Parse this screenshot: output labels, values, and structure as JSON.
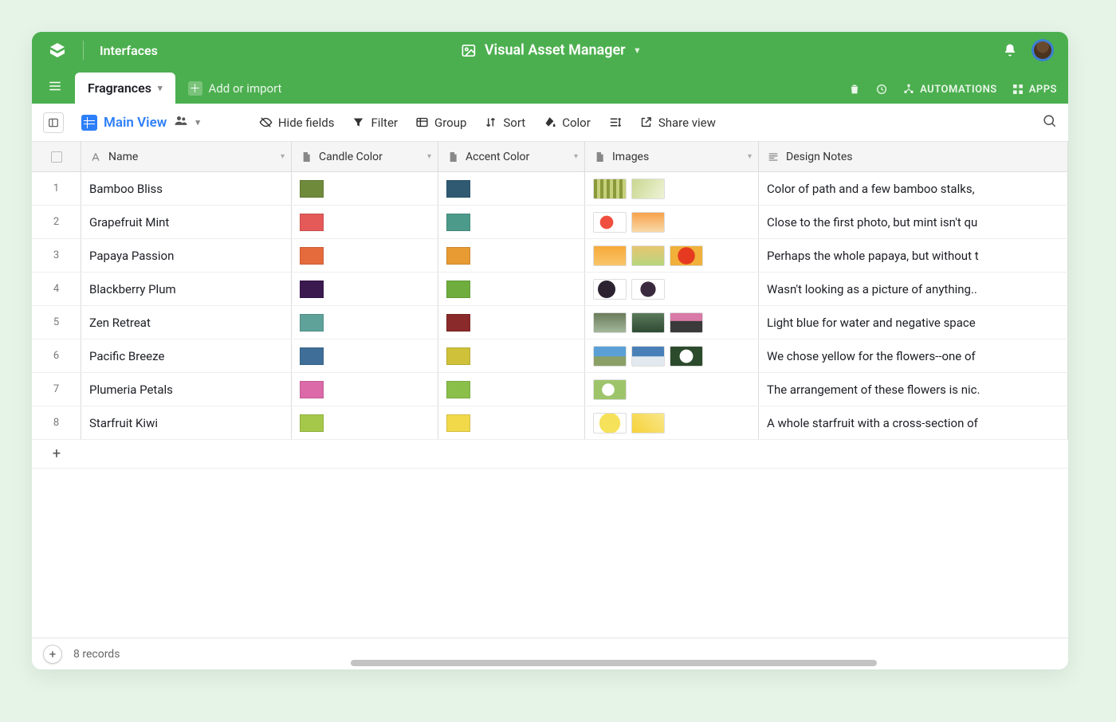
{
  "topbar": {
    "brand": "Interfaces",
    "title": "Visual Asset Manager"
  },
  "tabbar": {
    "active_tab": "Fragrances",
    "add_import": "Add or import",
    "automations": "AUTOMATIONS",
    "apps": "APPS"
  },
  "toolbar": {
    "view_name": "Main View",
    "hide_fields": "Hide fields",
    "filter": "Filter",
    "group": "Group",
    "sort": "Sort",
    "color": "Color",
    "share_view": "Share view"
  },
  "columns": {
    "name": "Name",
    "candle_color": "Candle Color",
    "accent_color": "Accent Color",
    "images": "Images",
    "design_notes": "Design Notes"
  },
  "rows": [
    {
      "num": "1",
      "name": "Bamboo Bliss",
      "c1": "#6f8a3b",
      "c2": "#2f5a72",
      "thumbs": [
        "th-bamboo1",
        "th-bamboo2"
      ],
      "notes": "Color of path and a few bamboo stalks,"
    },
    {
      "num": "2",
      "name": "Grapefruit Mint",
      "c1": "#e45a59",
      "c2": "#4c9a8a",
      "thumbs": [
        "th-grape1",
        "th-grape2"
      ],
      "notes": "Close to the first photo, but mint isn't qu"
    },
    {
      "num": "3",
      "name": "Papaya Passion",
      "c1": "#e56a3c",
      "c2": "#e89a33",
      "thumbs": [
        "th-pap1",
        "th-pap2",
        "th-pap3"
      ],
      "notes": "Perhaps the whole papaya, but without t"
    },
    {
      "num": "4",
      "name": "Blackberry Plum",
      "c1": "#3b1a50",
      "c2": "#6fae3e",
      "thumbs": [
        "th-bb1",
        "th-bb2"
      ],
      "notes": "Wasn't looking as a picture of anything.."
    },
    {
      "num": "5",
      "name": "Zen Retreat",
      "c1": "#5ea29a",
      "c2": "#8a2a2a",
      "thumbs": [
        "th-zen1",
        "th-zen2",
        "th-zen3"
      ],
      "notes": "Light blue for water and negative space"
    },
    {
      "num": "6",
      "name": "Pacific Breeze",
      "c1": "#3f6f98",
      "c2": "#cfc23a",
      "thumbs": [
        "th-pac1",
        "th-pac2",
        "th-pac3"
      ],
      "notes": "We chose yellow for the flowers--one of"
    },
    {
      "num": "7",
      "name": "Plumeria Petals",
      "c1": "#dc6aa8",
      "c2": "#8ac04a",
      "thumbs": [
        "th-plu1"
      ],
      "notes": "The arrangement of these flowers is nic."
    },
    {
      "num": "8",
      "name": "Starfruit Kiwi",
      "c1": "#a6c84a",
      "c2": "#f2d94a",
      "thumbs": [
        "th-star1",
        "th-star2"
      ],
      "notes": "A whole starfruit with a cross-section of"
    }
  ],
  "footer": {
    "records": "8 records"
  }
}
